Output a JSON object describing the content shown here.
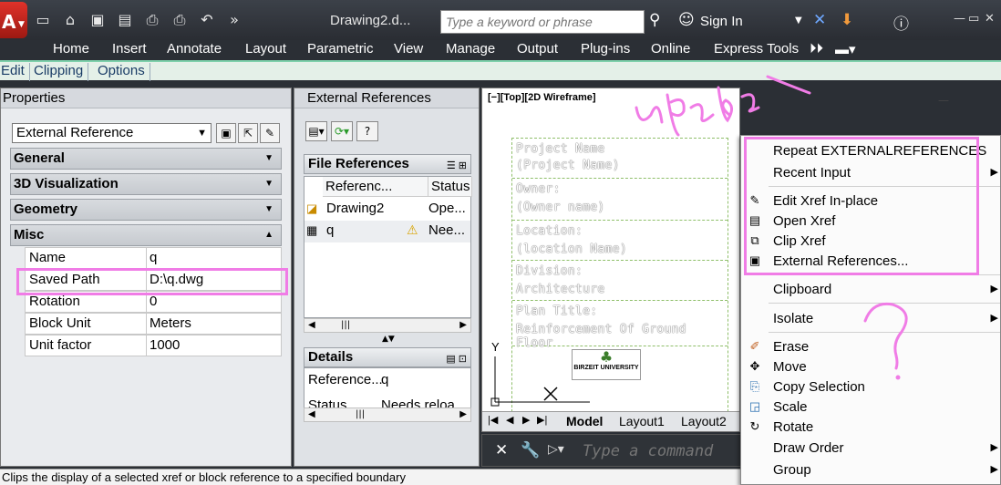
{
  "app": {
    "logo_letter": "A",
    "doc_title": "Drawing2.d...",
    "search_placeholder": "Type a keyword or phrase",
    "sign_in": "Sign In"
  },
  "menu": [
    "Home",
    "Insert",
    "Annotate",
    "Layout",
    "Parametric",
    "View",
    "Manage",
    "Output",
    "Plug-ins",
    "Online",
    "Express Tools"
  ],
  "context_tabs": [
    "Edit",
    "Clipping",
    "Options"
  ],
  "properties": {
    "title": "Properties",
    "selection": "External Reference",
    "categories": [
      "General",
      "3D Visualization",
      "Geometry",
      "Misc"
    ],
    "rows": [
      {
        "key": "Name",
        "value": "q"
      },
      {
        "key": "Saved Path",
        "value": "D:\\q.dwg"
      },
      {
        "key": "Rotation",
        "value": "0"
      },
      {
        "key": "Block Unit",
        "value": "Meters"
      },
      {
        "key": "Unit factor",
        "value": "1000"
      }
    ]
  },
  "xref": {
    "title": "External References",
    "file_refs_label": "File References",
    "columns": [
      "Referenc...",
      "Status"
    ],
    "rows": [
      {
        "name": "Drawing2",
        "status": "Ope..."
      },
      {
        "name": "q",
        "status": "Nee..."
      }
    ],
    "details_label": "Details",
    "details_rows": [
      {
        "key": "Reference...",
        "value": "q"
      },
      {
        "key": "Status",
        "value": "Needs reloa"
      }
    ]
  },
  "viewport": {
    "label": "[−][Top][2D Wireframe]",
    "title_block": [
      {
        "l1": "Project Name",
        "l2": "(Project Name)"
      },
      {
        "l1": "Owner:",
        "l2": "(Owner name)"
      },
      {
        "l1": "Location:",
        "l2": "(location Name)"
      },
      {
        "l1": "Division:",
        "l2": "Architecture"
      },
      {
        "l1": "Plan Title:",
        "l2": "Reinforcement Of Ground Floor"
      }
    ],
    "logo_text": "BIRZEIT UNIVERSITY",
    "axis_y": "Y",
    "tabs": [
      "Model",
      "Layout1",
      "Layout2"
    ]
  },
  "command": {
    "placeholder": "Type a command"
  },
  "status_text": "Clips the display of a selected xref or block reference to a specified boundary",
  "context_menu": [
    {
      "label": "Repeat EXTERNALREFERENCES",
      "icon": "",
      "sub": false
    },
    {
      "label": "Recent Input",
      "icon": "",
      "sub": true
    },
    {
      "label": "Edit Xref In-place",
      "icon": "edit-xref-icon",
      "sub": false
    },
    {
      "label": "Open Xref",
      "icon": "open-xref-icon",
      "sub": false
    },
    {
      "label": "Clip Xref",
      "icon": "clip-xref-icon",
      "sub": false
    },
    {
      "label": "External References...",
      "icon": "xref-manager-icon",
      "sub": false
    },
    {
      "label": "Clipboard",
      "icon": "",
      "sub": true
    },
    {
      "label": "Isolate",
      "icon": "",
      "sub": true
    },
    {
      "label": "Erase",
      "icon": "erase-icon",
      "sub": false
    },
    {
      "label": "Move",
      "icon": "move-icon",
      "sub": false
    },
    {
      "label": "Copy Selection",
      "icon": "copy-icon",
      "sub": false
    },
    {
      "label": "Scale",
      "icon": "scale-icon",
      "sub": false
    },
    {
      "label": "Rotate",
      "icon": "rotate-icon",
      "sub": false
    },
    {
      "label": "Draw Order",
      "icon": "",
      "sub": true
    },
    {
      "label": "Group",
      "icon": "",
      "sub": true
    }
  ],
  "colors": {
    "highlight": "#f07ce6",
    "ribbon_accent": "#7fd1ac",
    "chrome": "#2b2f35"
  }
}
